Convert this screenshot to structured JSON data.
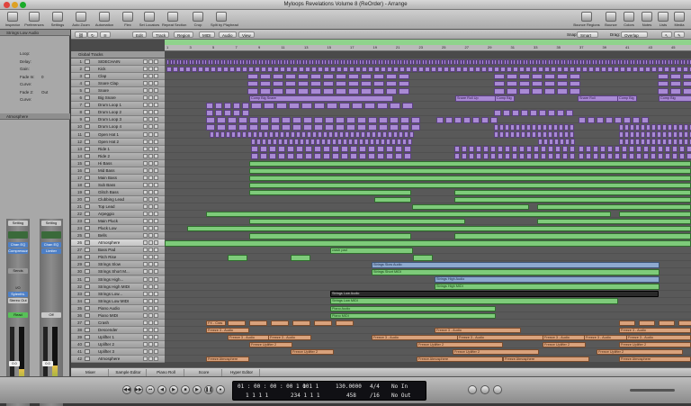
{
  "window": {
    "title": "Myloops Revelations Volume 8 (ReOrder) - Arrange"
  },
  "toolbar": {
    "left": [
      {
        "label": "Inspector",
        "icon": "info-icon"
      },
      {
        "label": "Preferences",
        "icon": "switch-icon"
      },
      {
        "label": "Settings",
        "icon": "gear-icon"
      },
      {
        "label": "Auto Zoom",
        "icon": "zoom-icon"
      },
      {
        "label": "Automation",
        "icon": "curve-icon"
      },
      {
        "label": "Flex",
        "icon": "flex-icon"
      },
      {
        "label": "Set Locators",
        "icon": "locator-icon"
      },
      {
        "label": "Repeat Section",
        "icon": "repeat-icon"
      },
      {
        "label": "Crop",
        "icon": "crop-icon"
      },
      {
        "label": "Split by Playhead",
        "icon": "split-icon"
      }
    ],
    "right": [
      {
        "label": "Bounce Regions",
        "icon": "bounce-icon"
      },
      {
        "label": "Bounce",
        "icon": "bounce-icon"
      },
      {
        "label": "Colors",
        "icon": "colors-icon"
      },
      {
        "label": "Notes",
        "icon": "notes-icon"
      },
      {
        "label": "Lists",
        "icon": "list-icon"
      },
      {
        "label": "Media",
        "icon": "media-icon"
      }
    ]
  },
  "inspector": {
    "region_header": "Strings Low Audio",
    "params": [
      {
        "label": "Loop:",
        "value": ""
      },
      {
        "label": "Delay:",
        "value": ""
      },
      {
        "label": "Gain:",
        "value": ""
      },
      {
        "label": "Fade In:",
        "value": "0"
      },
      {
        "label": "Curve:",
        "value": ""
      },
      {
        "label": "Fade 2:",
        "value": "Out"
      },
      {
        "label": "Curve:",
        "value": ""
      }
    ],
    "track_header": "Atmosphere",
    "strip1": {
      "setting": "Setting",
      "eq": "Chan EQ",
      "insert": "Compressor",
      "sends": "Sends",
      "io": "I/O",
      "input": "SylenthL",
      "output": "Stereo Out",
      "mode": "Read",
      "value": "0.0",
      "name": "Atmosphere"
    },
    "strip2": {
      "setting": "Setting",
      "eq": "Chan EQ",
      "insert": "Limiter",
      "mode": "Off",
      "value": "0.0",
      "name": "Output"
    }
  },
  "arrange_toolbar": {
    "menus": [
      "Edit",
      "Track",
      "Region",
      "MIDI",
      "Audio",
      "View"
    ],
    "snap_label": "Snap:",
    "snap_value": "Smart",
    "drag_label": "Drag:",
    "drag_value": "Overlap"
  },
  "ruler": {
    "ticks": [
      "1",
      "3",
      "5",
      "7",
      "9",
      "11",
      "13",
      "15",
      "17",
      "19",
      "21",
      "23",
      "25",
      "27",
      "29",
      "31",
      "33",
      "35",
      "37",
      "39",
      "41",
      "43",
      "45"
    ]
  },
  "global_tracks_label": "Global Tracks",
  "tracks": [
    {
      "n": "1",
      "name": "SIDECHAIN"
    },
    {
      "n": "2",
      "name": "Kick"
    },
    {
      "n": "3",
      "name": "Clap"
    },
    {
      "n": "4",
      "name": "Snare Clap"
    },
    {
      "n": "5",
      "name": "Snare"
    },
    {
      "n": "6",
      "name": "Big Snare"
    },
    {
      "n": "7",
      "name": "Drum Loop 1"
    },
    {
      "n": "8",
      "name": "Drum Loop 2"
    },
    {
      "n": "9",
      "name": "Drum Loop 3"
    },
    {
      "n": "10",
      "name": "Drum Loop 4"
    },
    {
      "n": "11",
      "name": "Open Hat 1"
    },
    {
      "n": "12",
      "name": "Open Hat 2"
    },
    {
      "n": "13",
      "name": "Ride 1"
    },
    {
      "n": "14",
      "name": "Ride 2"
    },
    {
      "n": "15",
      "name": "Hi Bass"
    },
    {
      "n": "16",
      "name": "Mid Bass"
    },
    {
      "n": "17",
      "name": "Main Bass"
    },
    {
      "n": "18",
      "name": "Sub Bass"
    },
    {
      "n": "19",
      "name": "Glitch Bass"
    },
    {
      "n": "20",
      "name": "Clubbing Lead"
    },
    {
      "n": "21",
      "name": "Top Lead"
    },
    {
      "n": "22",
      "name": "Arpeggio"
    },
    {
      "n": "23",
      "name": "Main Pluck"
    },
    {
      "n": "24",
      "name": "Pluck Low"
    },
    {
      "n": "25",
      "name": "Bells"
    },
    {
      "n": "26",
      "name": "Atmosphere",
      "selected": true
    },
    {
      "n": "27",
      "name": "Bass Pad"
    },
    {
      "n": "28",
      "name": "Pitch Rise"
    },
    {
      "n": "29",
      "name": "Strings Slow"
    },
    {
      "n": "30",
      "name": "Strings Short M..."
    },
    {
      "n": "31",
      "name": "Strings High..."
    },
    {
      "n": "32",
      "name": "Strings High MIDI"
    },
    {
      "n": "33",
      "name": "Strings Low..."
    },
    {
      "n": "34",
      "name": "Strings Low MIDI"
    },
    {
      "n": "35",
      "name": "Piano Audio"
    },
    {
      "n": "36",
      "name": "Piano MIDI"
    },
    {
      "n": "37",
      "name": "Crash"
    },
    {
      "n": "38",
      "name": "Descender"
    },
    {
      "n": "39",
      "name": "Uplifter 1"
    },
    {
      "n": "40",
      "name": "Uplifter 2"
    },
    {
      "n": "41",
      "name": "Uplifter 3"
    },
    {
      "n": "42",
      "name": "Atmosphere"
    }
  ],
  "region_labels": {
    "big_snare": "Comp Big Snare",
    "snare_roll": "Snare Roll Up",
    "snare_roll_short": "Snare Roll",
    "snare_hit": "Comp Big",
    "crash_pad": "crash pad",
    "strings_slow": "Strings Slow Audio",
    "strings_short": "Strings Short MIDI",
    "strings_high": "Strings High Audio",
    "strings_high_midi": "Strings High MIDI",
    "strings_low": "Strings Low Audio",
    "strings_low_midi": "Strings Low MIDI",
    "piano_audio": "Piano Audio",
    "piano_midi": "Piano MIDI",
    "crash": "FX - Cras",
    "freeze_audio": "Freeze 3 - Audio",
    "freeze_uplifter": "Freeze Uplifter 2",
    "freeze_atmo": "Freeze Atmosphere"
  },
  "bottom_tabs": [
    "Mixer",
    "Sample Editor",
    "Piano Roll",
    "Score",
    "Hyper Editor"
  ],
  "transport": {
    "position_smpte": "01 : 00 : 00 : 00 . 00",
    "position_bars": "1  1  1  1",
    "end_bars": "1  1  1  1",
    "end_small": "234  1  1  1",
    "tempo": "130.0000",
    "tempo_sub": "458",
    "signature": "4/4",
    "division": "/16",
    "in_label": "No In",
    "out_label": "No Out"
  },
  "colors": {
    "purple": "#a98ad4",
    "green": "#7ecb7a",
    "blue": "#8ea9cf",
    "orange": "#d9a27c",
    "cycle": "#8fd38c"
  }
}
